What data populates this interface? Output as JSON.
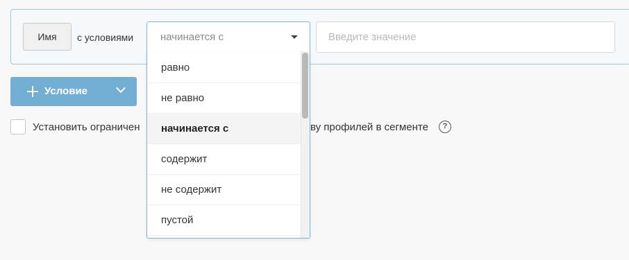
{
  "condition": {
    "field_label": "Имя",
    "with_conditions_label": "с условиями",
    "operator_selected": "начинается с",
    "value_placeholder": "Введите значение",
    "operator_options": [
      {
        "label": "равно",
        "selected": false
      },
      {
        "label": "не равно",
        "selected": false
      },
      {
        "label": "начинается с",
        "selected": true
      },
      {
        "label": "содержит",
        "selected": false
      },
      {
        "label": "не содержит",
        "selected": false
      },
      {
        "label": "пустой",
        "selected": false
      }
    ]
  },
  "add_condition": {
    "label": "Условие",
    "icon": "plus-icon",
    "toggle_icon": "chevron-down-icon"
  },
  "limit": {
    "checked": false,
    "label_left": "Установить ограничен",
    "label_right": "ву профилей в сегменте",
    "help_glyph": "?"
  },
  "colors": {
    "accent": "#72aed4",
    "panel_border": "#9fc6de",
    "panel_bg": "#f5f9fc",
    "page_bg": "#f8f8f8"
  }
}
